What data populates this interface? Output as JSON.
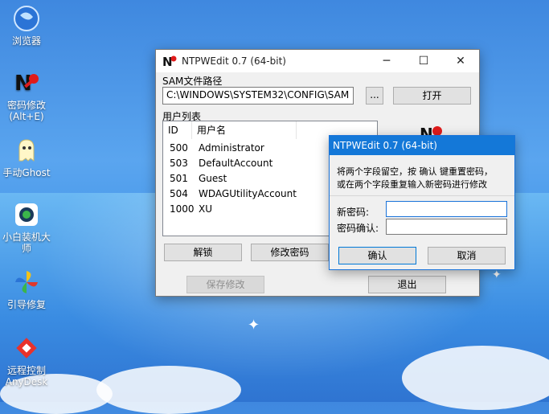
{
  "desktop": {
    "icons": [
      {
        "label": "浏览器",
        "icon": "globe-icon"
      },
      {
        "label": "密码修改\n(Alt+E)",
        "icon": "key-icon"
      },
      {
        "label": "手动Ghost",
        "icon": "ghost-icon"
      },
      {
        "label": "小白装机大\n师",
        "icon": "installer-icon"
      },
      {
        "label": "引导修复",
        "icon": "pinwheel-icon"
      },
      {
        "label": "远程控制\nAnyDesk",
        "icon": "anydesk-icon"
      }
    ]
  },
  "main_window": {
    "title": "NTPWEdit 0.7 (64-bit)",
    "sam_label": "SAM文件路径",
    "sam_path": "C:\\WINDOWS\\SYSTEM32\\CONFIG\\SAM",
    "browse_label": "...",
    "open_label": "打开",
    "user_list_label": "用户列表",
    "columns": [
      "ID",
      "用户名"
    ],
    "users": [
      {
        "id": "500",
        "name": "Administrator"
      },
      {
        "id": "503",
        "name": "DefaultAccount"
      },
      {
        "id": "501",
        "name": "Guest"
      },
      {
        "id": "504",
        "name": "WDAGUtilityAccount"
      },
      {
        "id": "1000",
        "name": "XU"
      }
    ],
    "unlock_label": "解锁",
    "change_pw_label": "修改密码",
    "save_label": "保存修改",
    "exit_label": "退出"
  },
  "dialog": {
    "title": "NTPWEdit 0.7 (64-bit)",
    "instruction_line1": "将两个字段留空，按 确认 键重置密码，",
    "instruction_line2": "或在两个字段重复输入新密码进行修改",
    "new_pw_label": "新密码:",
    "confirm_pw_label": "密码确认:",
    "new_pw_value": "",
    "confirm_pw_value": "",
    "ok_label": "确认",
    "cancel_label": "取消"
  }
}
